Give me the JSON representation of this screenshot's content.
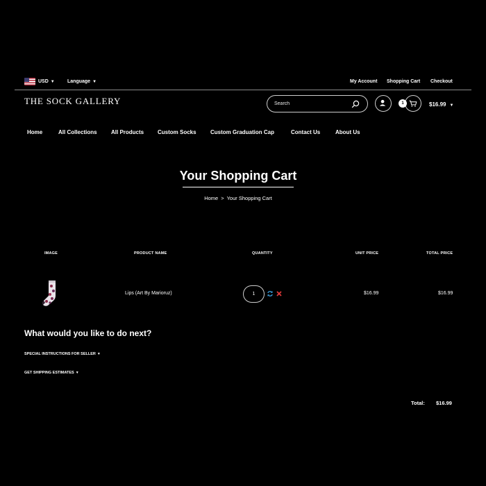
{
  "topbar": {
    "currency": "USD",
    "language": "Language",
    "links": [
      "My Account",
      "Shopping Cart",
      "Checkout"
    ]
  },
  "header": {
    "logo": "THE SOCK GALLERY",
    "search_placeholder": "Search",
    "cart_count": "1",
    "cart_total": "$16.99"
  },
  "nav": [
    "Home",
    "All Collections",
    "All Products",
    "Custom Socks",
    "Custom Graduation Cap",
    "Contact Us",
    "About Us"
  ],
  "page": {
    "title": "Your Shopping Cart",
    "breadcrumb": [
      "Home",
      "Your Shopping Cart"
    ],
    "breadcrumb_separator": ">"
  },
  "cart": {
    "columns": [
      "IMAGE",
      "PRODUCT NAME",
      "QUANTITY",
      "UNIT PRICE",
      "TOTAL PRICE"
    ],
    "items": [
      {
        "name": "Lips (Art By Marioruz)",
        "quantity": "1",
        "unit_price": "$16.99",
        "total_price": "$16.99"
      }
    ],
    "total_label": "Total:",
    "total_value": "$16.99"
  },
  "next_steps": {
    "heading": "What would you like to do next?",
    "special_instructions": "SPECIAL INSTRUCTIONS FOR SELLER",
    "shipping_estimates": "GET SHIPPING ESTIMATES"
  },
  "colors": {
    "background": "#000000",
    "text": "#ffffff",
    "refresh_icon": "#3aa0e0",
    "remove_icon": "#e03a3a"
  }
}
